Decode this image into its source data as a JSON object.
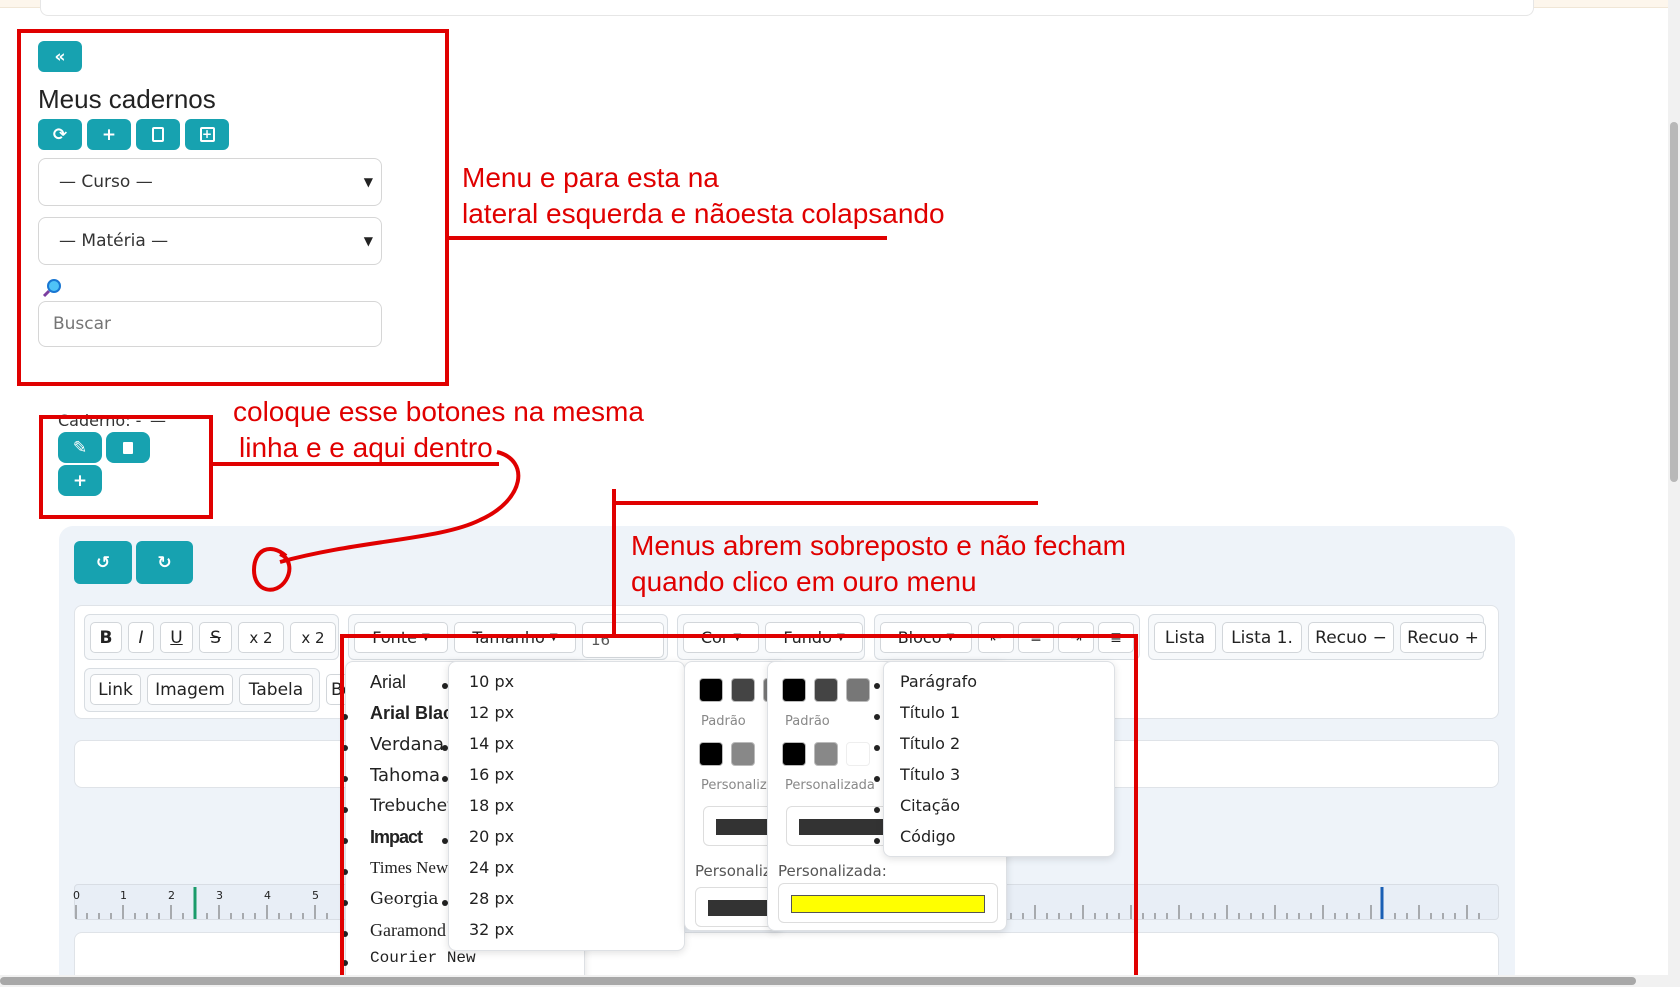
{
  "sidebar": {
    "title": "Meus cadernos",
    "curso_select": "— Curso —",
    "materia_select": "— Matéria —",
    "search_placeholder": "Buscar"
  },
  "caderno": {
    "label": "Caderno: -",
    "dash": "—"
  },
  "annotations": {
    "note1_line1": "Menu e para esta na",
    "note1_line2": "lateral esquerda e nãoesta colapsando",
    "note2_line1": "coloque esse botones na mesma",
    "note2_line2": "linha e e aqui dentro",
    "note3_line1": "Menus abrem sobreposto e não fecham",
    "note3_line2": "quando clico em ouro menu"
  },
  "toolbar": {
    "bold": "B",
    "italic": "I",
    "underline": "U",
    "strike": "S",
    "sub": "x 2",
    "sup": "x 2",
    "fonte": "Fonte",
    "tamanho": "Tamanho",
    "size_value": "16",
    "cor": "Cor",
    "fundo": "Fundo",
    "bloco": "Bloco",
    "lista": "Lista",
    "lista_num": "Lista 1.",
    "recuo_menos": "Recuo −",
    "recuo_mais": "Recuo +",
    "link": "Link",
    "imagem": "Imagem",
    "tabela": "Tabela",
    "partial": "Bo"
  },
  "font_menu": [
    "Arial",
    "Arial Black",
    "Verdana",
    "Tahoma",
    "Trebuchet",
    "Impact",
    "Times New",
    "Georgia",
    "Garamond",
    "Courier New"
  ],
  "size_menu": [
    "10 px",
    "12 px",
    "14 px",
    "16 px",
    "18 px",
    "20 px",
    "24 px",
    "28 px",
    "32 px"
  ],
  "block_menu": [
    "Parágrafo",
    "Título 1",
    "Título 2",
    "Título 3",
    "Citação",
    "Código"
  ],
  "color_panel": {
    "default_label": "Padrão",
    "custom_label": "Personaliza",
    "custom_full": "Personalizada",
    "custom_colon": "Personaliza"
  },
  "bg_panel": {
    "default_label": "Padrão",
    "custom_label": "Personalizada",
    "custom_colon": "Personalizada:",
    "highlight_color": "#ffff00"
  },
  "ruler": {
    "numbers": [
      "0",
      "1",
      "2",
      "3",
      "4",
      "5"
    ]
  },
  "colors": {
    "accent": "#17a2b0",
    "annotation": "#e00000"
  }
}
